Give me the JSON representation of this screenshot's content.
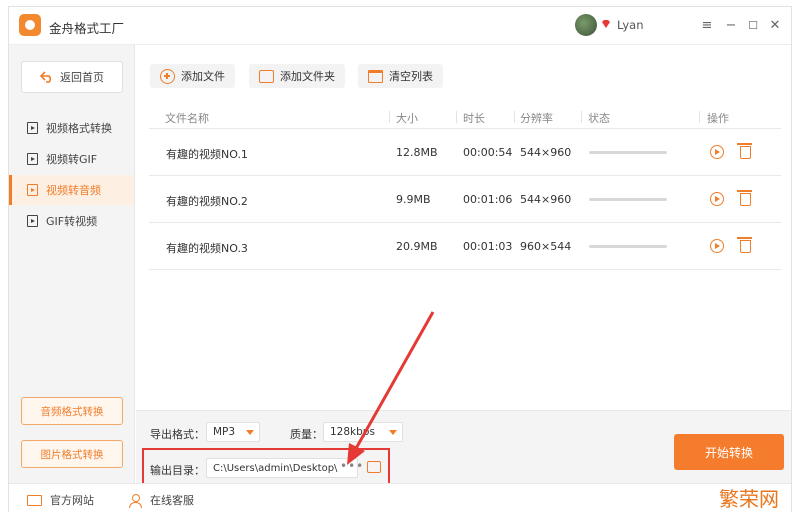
{
  "app": {
    "title": "金舟格式工厂",
    "username": "Lyan",
    "window_controls": {
      "menu": "≡",
      "minimize": "−",
      "maximize": "☐",
      "close": "✕"
    }
  },
  "sidebar": {
    "back_label": "返回首页",
    "items": [
      {
        "label": "视频格式转换",
        "active": false
      },
      {
        "label": "视频转GIF",
        "active": false
      },
      {
        "label": "视频转音频",
        "active": true
      },
      {
        "label": "GIF转视频",
        "active": false
      }
    ],
    "bottom_buttons": [
      "音频格式转换",
      "图片格式转换"
    ]
  },
  "toolbar": {
    "add_file": "添加文件",
    "add_folder": "添加文件夹",
    "clear_list": "清空列表"
  },
  "table": {
    "headers": {
      "name": "文件名称",
      "size": "大小",
      "duration": "时长",
      "resolution": "分辨率",
      "status": "状态",
      "actions": "操作"
    },
    "rows": [
      {
        "name": "有趣的视频NO.1",
        "size": "12.8MB",
        "duration": "00:00:54",
        "resolution": "544×960",
        "progress": 0
      },
      {
        "name": "有趣的视频NO.2",
        "size": "9.9MB",
        "duration": "00:01:06",
        "resolution": "544×960",
        "progress": 0
      },
      {
        "name": "有趣的视频NO.3",
        "size": "20.9MB",
        "duration": "00:01:03",
        "resolution": "960×544",
        "progress": 0
      }
    ]
  },
  "settings": {
    "format_label": "导出格式：",
    "format_value": "MP3",
    "quality_label": "质量：",
    "quality_value": "128kbps",
    "output_label": "输出目录：",
    "output_path": "C:\\Users\\admin\\Desktop\\",
    "browse_dots": "•••",
    "start_button": "开始转换"
  },
  "footer": {
    "website": "官方网站",
    "support": "在线客服"
  },
  "watermark": "繁荣网",
  "colors": {
    "accent": "#f07d2a",
    "annotation_red": "#e53935"
  },
  "icons": {
    "logo": "app-logo-icon",
    "gem": "vip-gem-icon",
    "back": "back-arrow-icon",
    "add": "add-circle-icon",
    "folder": "folder-icon",
    "clear": "basket-icon",
    "play": "play-icon",
    "delete": "trash-icon",
    "website": "monitor-icon",
    "support": "person-icon"
  }
}
